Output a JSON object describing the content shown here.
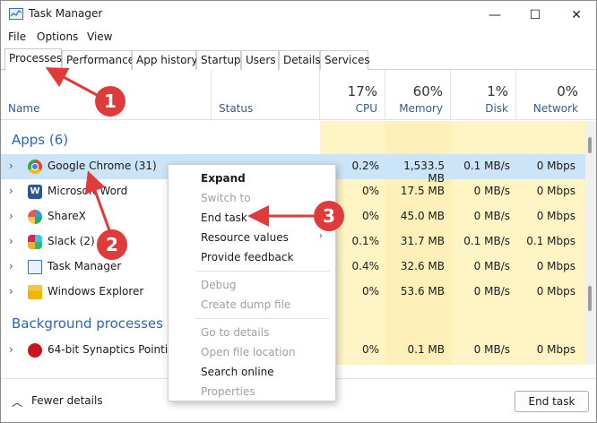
{
  "window": {
    "title": "Task Manager",
    "controls": {
      "minimize": "—",
      "maximize": "☐",
      "close": "✕"
    }
  },
  "menubar": {
    "file": "File",
    "options": "Options",
    "view": "View"
  },
  "tabs": [
    {
      "label": "Processes",
      "active": true
    },
    {
      "label": "Performance"
    },
    {
      "label": "App history"
    },
    {
      "label": "Startup"
    },
    {
      "label": "Users"
    },
    {
      "label": "Details"
    },
    {
      "label": "Services"
    }
  ],
  "header": {
    "name": "Name",
    "status": "Status",
    "cpu": {
      "pct": "17%",
      "label": "CPU"
    },
    "memory": {
      "pct": "60%",
      "label": "Memory"
    },
    "disk": {
      "pct": "1%",
      "label": "Disk"
    },
    "network": {
      "pct": "0%",
      "label": "Network"
    }
  },
  "groups": {
    "apps": "Apps (6)",
    "background": "Background processes (1"
  },
  "rows": [
    {
      "name": "Google Chrome (31)",
      "cpu": "0.2%",
      "memory": "1,533.5 MB",
      "disk": "0.1 MB/s",
      "network": "0 Mbps"
    },
    {
      "name": "Microsoft Word",
      "cpu": "0%",
      "memory": "17.5 MB",
      "disk": "0 MB/s",
      "network": "0 Mbps"
    },
    {
      "name": "ShareX",
      "cpu": "0%",
      "memory": "45.0 MB",
      "disk": "0 MB/s",
      "network": "0 Mbps"
    },
    {
      "name": "Slack (2)",
      "cpu": "0.1%",
      "memory": "31.7 MB",
      "disk": "0.1 MB/s",
      "network": "0.1 Mbps"
    },
    {
      "name": "Task Manager",
      "cpu": "0.4%",
      "memory": "32.6 MB",
      "disk": "0 MB/s",
      "network": "0 Mbps"
    },
    {
      "name": "Windows Explorer",
      "cpu": "0%",
      "memory": "53.6 MB",
      "disk": "0 MB/s",
      "network": "0 Mbps"
    },
    {
      "name": "64-bit Synaptics Pointing",
      "cpu": "0%",
      "memory": "0.1 MB",
      "disk": "0 MB/s",
      "network": "0 Mbps"
    }
  ],
  "context_menu": {
    "expand": "Expand",
    "switch_to": "Switch to",
    "end_task": "End task",
    "resource_values": "Resource values",
    "provide_feedback": "Provide feedback",
    "debug": "Debug",
    "create_dump": "Create dump file",
    "go_to_details": "Go to details",
    "open_location": "Open file location",
    "search_online": "Search online",
    "properties": "Properties"
  },
  "footer": {
    "fewer_details": "Fewer details",
    "end_task": "End task"
  },
  "annotations": {
    "one": "1",
    "two": "2",
    "three": "3"
  },
  "colors": {
    "accent": "#2a66b8",
    "annotation": "#e03b3b",
    "selected_row": "#cce4f7",
    "heat_light": "#fff4c4",
    "heat_mid": "#ffe9a8"
  }
}
